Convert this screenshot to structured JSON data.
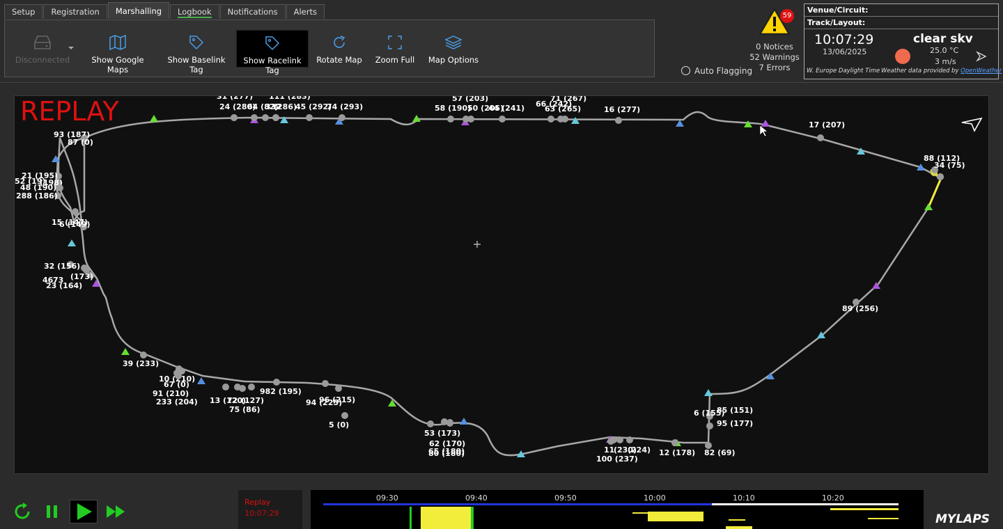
{
  "tabs": [
    "Setup",
    "Registration",
    "Marshalling",
    "Logbook",
    "Notifications",
    "Alerts"
  ],
  "toolbar": {
    "disconnected": "Disconnected",
    "google_maps": "Show Google Maps",
    "baselink": "Show Baselink Tag",
    "racelink": "Show Racelink Tag",
    "rotate": "Rotate Map",
    "zoom": "Zoom Full",
    "options": "Map Options"
  },
  "auto_flagging": "Auto Flagging",
  "alerts": {
    "badge": "59",
    "notices": "0 Notices",
    "warnings": "52 Warnings",
    "errors": "7 Errors"
  },
  "venue": {
    "venue_label": "Venue/Circuit:",
    "track_label": "Track/Layout:",
    "clock": "10:07:29",
    "date": "13/06/2025",
    "weather": "clear skv",
    "temp": "25.0 °C",
    "wind": "3 m/s",
    "timezone": "W. Europe Daylight Time",
    "provider_prefix": "Weather data provided by ",
    "provider": "OpenWeather"
  },
  "map": {
    "title": "REPLAY",
    "labels": [
      "31 (277)",
      "111 (283)",
      "24 (280)",
      "64 (82)",
      "332",
      "(286)",
      "45 (292)",
      "74 (293)",
      "57 (203)",
      "58 (190)",
      "50 (205)",
      "44 (241)",
      "71 (267)",
      "66 (242)",
      "63 (265)",
      "16 (277)",
      "93 (187)",
      "87 (0)",
      "17 (207)",
      "88 (112)",
      "34 (75)",
      "21 (195)",
      "52 (19)",
      "(198)",
      "48 (190)",
      "288 (186)",
      "15 (147)",
      "6 (149)",
      "32 (156)",
      "46",
      "73",
      "(173)",
      "23 (164)",
      "89 (256)",
      "39 (233)",
      "10 (210)",
      "67 (0)",
      "91 (210)",
      "233 (204)",
      "13 (120)",
      "72",
      "(127)",
      "75 (86)",
      "982 (195)",
      "94 (225)",
      "96 (215)",
      "5 (0)",
      "53 (173)",
      "62 (170)",
      "65 (180)",
      "80 (180)",
      "85 (151)",
      "6 (155)",
      "95 (177)",
      "11",
      "(230)",
      "(224)",
      "100 (237)",
      "12 (178)",
      "82 (69)"
    ]
  },
  "playback": {
    "replay_label": "Replay",
    "replay_time": "10:07:29",
    "ticks": [
      "09:30",
      "09:40",
      "09:50",
      "10:00",
      "10:10",
      "10:20"
    ]
  },
  "brand": "MYLAPS",
  "colors": {
    "replay_red": "#dd1111",
    "track": "#a8a8a8",
    "green_marker": "#66dd33",
    "blue_marker": "#5590e0",
    "cyan_marker": "#66c8dd",
    "purple_marker": "#aa55dd",
    "timeline_yellow": "#f2ec3a",
    "play_green": "#22cc22"
  }
}
